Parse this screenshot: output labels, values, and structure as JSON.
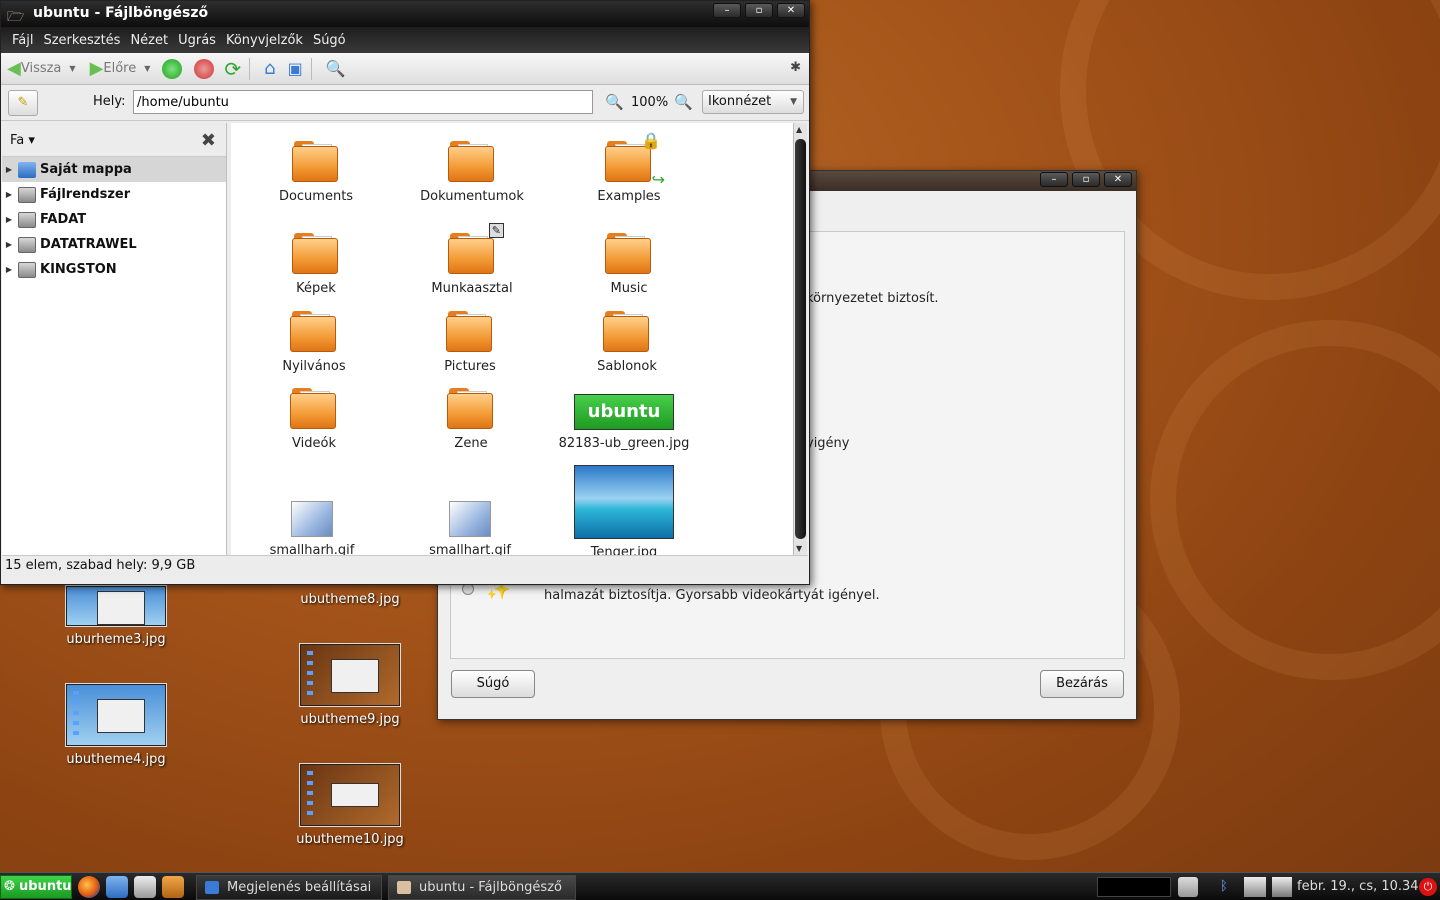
{
  "desktop": {
    "icons": [
      {
        "label": "uburheme3.jpg"
      },
      {
        "label": "ubutheme4.jpg"
      },
      {
        "label": "ubutheme8.jpg"
      },
      {
        "label": "ubutheme9.jpg"
      },
      {
        "label": "ubutheme10.jpg"
      }
    ]
  },
  "appearance_dialog": {
    "text_env": "környezetet biztosít.",
    "text_req": "yigény",
    "text_fx": "halmazát biztosítja. Gyorsabb videokártyát igényel.",
    "help_button": "Súgó",
    "close_button": "Bezárás"
  },
  "file_browser": {
    "title": "ubuntu - Fájlböngésző",
    "menu": [
      "Fájl",
      "Szerkesztés",
      "Nézet",
      "Ugrás",
      "Könyvjelzők",
      "Súgó"
    ],
    "toolbar": {
      "back": "Vissza",
      "forward": "Előre"
    },
    "location": {
      "label": "Hely:",
      "value": "/home/ubuntu"
    },
    "zoom": "100%",
    "view_mode": "Ikonnézet",
    "sidebar": {
      "header": "Fa",
      "items": [
        {
          "label": "Saját mappa",
          "icon": "home-icon",
          "selected": true
        },
        {
          "label": "Fájlrendszer",
          "icon": "drive-icon"
        },
        {
          "label": "FADAT",
          "icon": "drive-icon"
        },
        {
          "label": "DATATRAWEL",
          "icon": "drive-icon"
        },
        {
          "label": "KINGSTON",
          "icon": "drive-icon"
        }
      ]
    },
    "files": [
      {
        "name": "Documents",
        "type": "folder"
      },
      {
        "name": "Dokumentumok",
        "type": "folder"
      },
      {
        "name": "Examples",
        "type": "folder-link-locked"
      },
      {
        "name": "Képek",
        "type": "folder"
      },
      {
        "name": "Munkaasztal",
        "type": "folder-desktop"
      },
      {
        "name": "Music",
        "type": "folder"
      },
      {
        "name": "Nyilvános",
        "type": "folder"
      },
      {
        "name": "Pictures",
        "type": "folder"
      },
      {
        "name": "Sablonok",
        "type": "folder"
      },
      {
        "name": "Videók",
        "type": "folder"
      },
      {
        "name": "Zene",
        "type": "folder"
      },
      {
        "name": "82183-ub_green.jpg",
        "type": "image",
        "thumb_text": "ubuntu"
      },
      {
        "name": "smallharh.gif",
        "type": "image"
      },
      {
        "name": "smallhart.gif",
        "type": "image"
      },
      {
        "name": "Tenger.jpg",
        "type": "image"
      }
    ],
    "status": "15 elem, szabad hely: 9,9 GB"
  },
  "taskbar": {
    "menu_label": "ubuntu",
    "tasks": [
      {
        "label": "Megjelenés beállításai"
      },
      {
        "label": "ubuntu - Fájlböngésző"
      }
    ],
    "clock": "febr. 19., cs, 10.34"
  },
  "colors": {
    "desktop": "#a8571b",
    "folder": "#f39a35",
    "ubuntu_green": "#2fbf3a"
  }
}
